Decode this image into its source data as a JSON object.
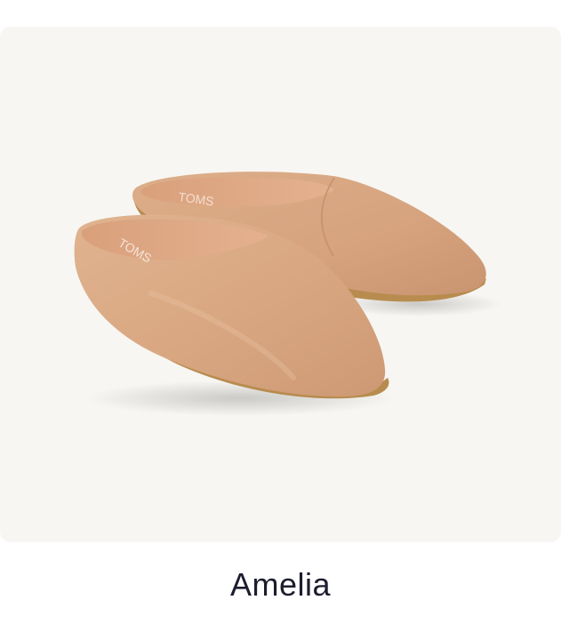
{
  "product": {
    "name": "Amelia",
    "image_alt": "Tan leather mule shoes",
    "insole_brand": "TOMS"
  },
  "colors": {
    "card_background": "#f7f6f3",
    "leather": "#d9a882",
    "leather_shadow": "#c68f6b",
    "sole": "#b88c4f",
    "name_text": "#1c1d2e"
  }
}
